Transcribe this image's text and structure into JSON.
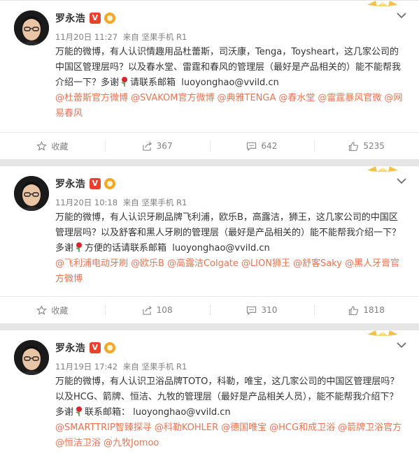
{
  "posts": [
    {
      "author": "罗永浩",
      "verified_badge": "V",
      "date": "11月20日 11:27",
      "source": "来自 坚果手机 R1",
      "body_before_rose": "万能的微博，有人认识情趣用品杜蕾斯，司沃康，Tenga，Toysheart，这几家公司的中国区管理层吗？以及春水堂、雷霆和春风的管理层（最好是产品相关的）能不能帮我介绍一下？多谢",
      "body_after_rose": "请联系邮箱",
      "email": "luoyonghao@vvild.cn",
      "mentions": [
        "@杜蕾斯官方微博",
        "@SVAKOM官方微博",
        "@典雅TENGA",
        "@春水堂",
        "@雷霆暴风官微",
        "@网易春风"
      ],
      "actions": {
        "favorite": "收藏",
        "repost": "367",
        "comment": "642",
        "like": "5235"
      }
    },
    {
      "author": "罗永浩",
      "verified_badge": "V",
      "date": "11月20日 10:18",
      "source": "来自 坚果手机 R1",
      "body_before_rose": "万能的微博，有人认识牙刷品牌飞利浦，欧乐B，高露洁，狮王，这几家公司的中国区管理层吗？以及舒客和黑人牙刷的管理层（最好是产品相关的）能不能帮我介绍一下？多谢",
      "body_after_rose": "方便的话请联系邮箱",
      "email": "luoyonghao@vvild.cn",
      "mentions": [
        "@飞利浦电动牙刷",
        "@欧乐B",
        "@高露洁Colgate",
        "@LION狮王",
        "@舒客Saky",
        "@黑人牙膏官方微博"
      ],
      "actions": {
        "favorite": "收藏",
        "repost": "108",
        "comment": "310",
        "like": "1818"
      }
    },
    {
      "author": "罗永浩",
      "verified_badge": "V",
      "date": "11月19日 17:42",
      "source": "来自 坚果手机 R1",
      "body_before_rose": "万能的微博，有人认识卫浴品牌TOTO，科勒，唯宝，这几家公司的中国区管理层吗？以及HCG、箭牌、恒洁、九牧的管理层（最好是产品相关人员），能不能帮我介绍下？多谢",
      "body_after_rose": "联系邮箱：",
      "email": "luoyonghao@vvild.cn",
      "mentions": [
        "@SMARTTRIP智臻探寻",
        "@科勒KOHLER",
        "@德国唯宝",
        "@HCG和成卫浴",
        "@箭牌卫浴官方",
        "@恒洁卫浴",
        "@九牧Jomoo"
      ],
      "actions": {
        "favorite": "收藏",
        "repost": "",
        "comment": "",
        "like": ""
      }
    }
  ],
  "icons": {
    "favorite": "star-icon",
    "repost": "share-icon",
    "comment": "comment-icon",
    "like": "thumbs-up-icon",
    "menu": "chevron-down-icon"
  },
  "colors": {
    "mention": "#eb7350",
    "verified": "#e9412d",
    "meta": "#808080"
  }
}
